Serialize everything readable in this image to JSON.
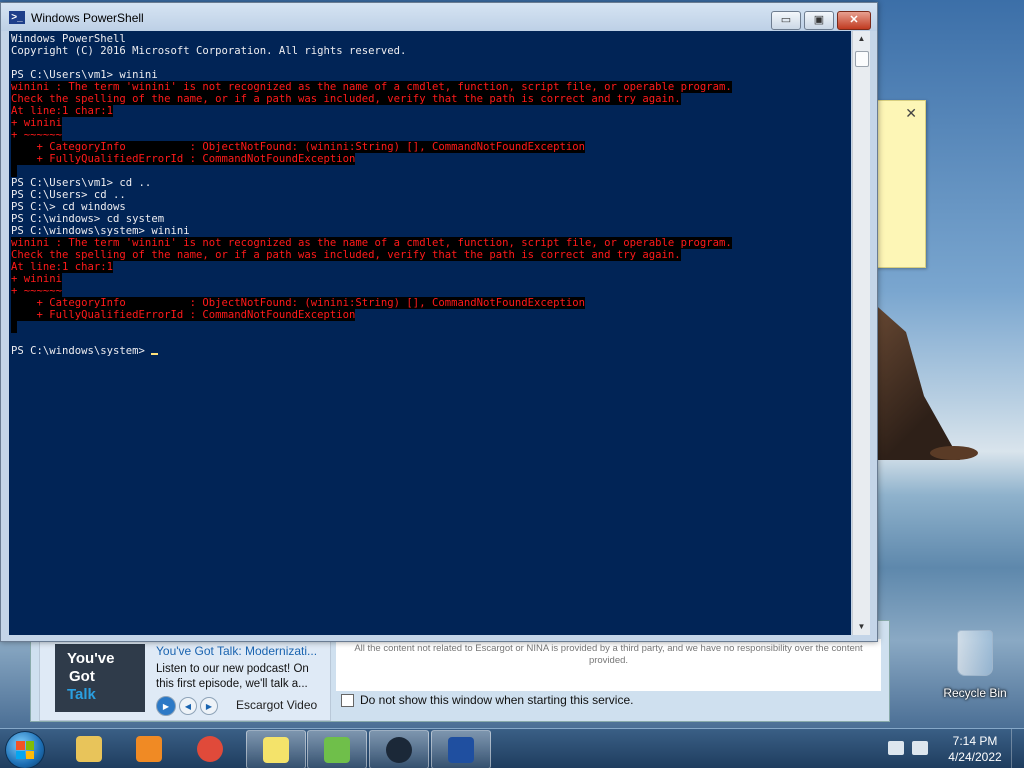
{
  "powershell": {
    "title": "Windows PowerShell",
    "title_icon": "powershell-icon",
    "controls": {
      "minimize": "▭",
      "maximize": "▣",
      "close": "✕"
    },
    "lines": [
      {
        "text": "Windows PowerShell",
        "type": "normal"
      },
      {
        "text": "Copyright (C) 2016 Microsoft Corporation. All rights reserved.",
        "type": "normal"
      },
      {
        "text": "",
        "type": "normal"
      },
      {
        "text": "PS C:\\Users\\vm1> winini",
        "type": "normal"
      },
      {
        "text": "winini : The term 'winini' is not recognized as the name of a cmdlet, function, script file, or operable program.",
        "type": "error"
      },
      {
        "text": "Check the spelling of the name, or if a path was included, verify that the path is correct and try again.",
        "type": "error"
      },
      {
        "text": "At line:1 char:1",
        "type": "error"
      },
      {
        "text": "+ winini",
        "type": "error"
      },
      {
        "text": "+ ~~~~~~",
        "type": "error"
      },
      {
        "text": "    + CategoryInfo          : ObjectNotFound: (winini:String) [], CommandNotFoundException",
        "type": "error"
      },
      {
        "text": "    + FullyQualifiedErrorId : CommandNotFoundException",
        "type": "error"
      },
      {
        "text": " ",
        "type": "error"
      },
      {
        "text": "PS C:\\Users\\vm1> cd ..",
        "type": "normal"
      },
      {
        "text": "PS C:\\Users> cd ..",
        "type": "normal"
      },
      {
        "text": "PS C:\\> cd windows",
        "type": "normal"
      },
      {
        "text": "PS C:\\windows> cd system",
        "type": "normal"
      },
      {
        "text": "PS C:\\windows\\system> winini",
        "type": "normal"
      },
      {
        "text": "winini : The term 'winini' is not recognized as the name of a cmdlet, function, script file, or operable program.",
        "type": "error"
      },
      {
        "text": "Check the spelling of the name, or if a path was included, verify that the path is correct and try again.",
        "type": "error"
      },
      {
        "text": "At line:1 char:1",
        "type": "error"
      },
      {
        "text": "+ winini",
        "type": "error"
      },
      {
        "text": "+ ~~~~~~",
        "type": "error"
      },
      {
        "text": "    + CategoryInfo          : ObjectNotFound: (winini:String) [], CommandNotFoundException",
        "type": "error"
      },
      {
        "text": "    + FullyQualifiedErrorId : CommandNotFoundException",
        "type": "error"
      },
      {
        "text": " ",
        "type": "error"
      },
      {
        "text": "",
        "type": "normal"
      },
      {
        "text": "PS C:\\windows\\system> ",
        "type": "prompt"
      }
    ],
    "scrollbar": {
      "up": "▲",
      "down": "▼"
    }
  },
  "sticky_note": {
    "close": "✕"
  },
  "promo": {
    "thumb_line1": "You've",
    "thumb_line2": "Got",
    "thumb_line3": "Talk",
    "title": "You've Got Talk: Modernizati...",
    "description": "Listen to our new podcast! On this first episode, we'll talk a...",
    "channel": "Escargot Video",
    "controls": {
      "play": "▶",
      "prev": "◀",
      "next": "▶"
    }
  },
  "dialog": {
    "disclaimer": "All the content not related to Escargot or NINA is provided by a third party, and we have no responsibility over the content provided.",
    "dont_show_label": "Do not show this window when starting this service."
  },
  "desktop": {
    "recycle_bin_label": "Recycle Bin"
  },
  "taskbar": {
    "time": "7:14 PM",
    "date": "4/24/2022",
    "items": [
      {
        "name": "explorer",
        "icon": "folder-icon",
        "color": "#e8c45a"
      },
      {
        "name": "media-player",
        "icon": "media-player-icon",
        "color": "#f08a24"
      },
      {
        "name": "chrome",
        "icon": "chrome-icon",
        "color": "#e04a3a"
      },
      {
        "name": "sticky-notes",
        "icon": "sticky-notes-icon",
        "color": "#f4e36a"
      },
      {
        "name": "messenger",
        "icon": "messenger-icon",
        "color": "#6fbf4a"
      },
      {
        "name": "steam",
        "icon": "steam-icon",
        "color": "#1b2838"
      },
      {
        "name": "powershell",
        "icon": "powershell-icon",
        "color": "#1f4fa0"
      }
    ]
  }
}
